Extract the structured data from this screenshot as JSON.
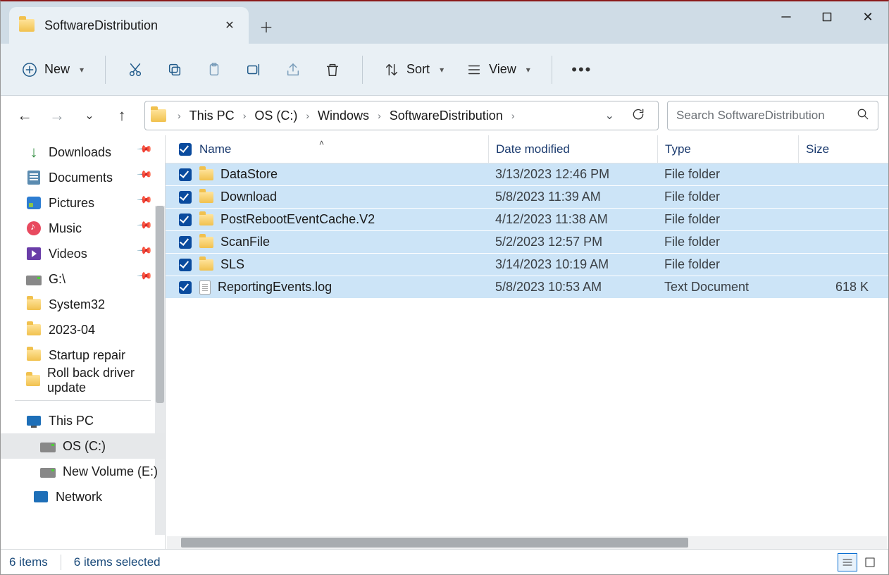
{
  "window": {
    "tab_title": "SoftwareDistribution"
  },
  "toolbar": {
    "new_label": "New",
    "sort_label": "Sort",
    "view_label": "View"
  },
  "breadcrumb": {
    "items": [
      "This PC",
      "OS (C:)",
      "Windows",
      "SoftwareDistribution"
    ]
  },
  "search": {
    "placeholder": "Search SoftwareDistribution"
  },
  "sidebar": {
    "quick": [
      {
        "label": "Downloads",
        "icon": "download",
        "pinned": true
      },
      {
        "label": "Documents",
        "icon": "doc",
        "pinned": true
      },
      {
        "label": "Pictures",
        "icon": "pic",
        "pinned": true
      },
      {
        "label": "Music",
        "icon": "music",
        "pinned": true
      },
      {
        "label": "Videos",
        "icon": "vid",
        "pinned": true
      },
      {
        "label": "G:\\",
        "icon": "drive",
        "pinned": true
      },
      {
        "label": "System32",
        "icon": "folder",
        "pinned": false
      },
      {
        "label": "2023-04",
        "icon": "folder",
        "pinned": false
      },
      {
        "label": "Startup repair",
        "icon": "folder",
        "pinned": false
      },
      {
        "label": "Roll back driver update",
        "icon": "folder",
        "pinned": false
      }
    ],
    "pc_label": "This PC",
    "drives": [
      {
        "label": "OS (C:)",
        "selected": true
      },
      {
        "label": "New Volume (E:)",
        "selected": false
      }
    ],
    "network_label": "Network"
  },
  "columns": {
    "name": "Name",
    "date": "Date modified",
    "type": "Type",
    "size": "Size"
  },
  "files": [
    {
      "name": "DataStore",
      "date": "3/13/2023 12:46 PM",
      "type": "File folder",
      "size": "",
      "icon": "folder",
      "selected": true
    },
    {
      "name": "Download",
      "date": "5/8/2023 11:39 AM",
      "type": "File folder",
      "size": "",
      "icon": "folder",
      "selected": true
    },
    {
      "name": "PostRebootEventCache.V2",
      "date": "4/12/2023 11:38 AM",
      "type": "File folder",
      "size": "",
      "icon": "folder",
      "selected": true
    },
    {
      "name": "ScanFile",
      "date": "5/2/2023 12:57 PM",
      "type": "File folder",
      "size": "",
      "icon": "folder",
      "selected": true
    },
    {
      "name": "SLS",
      "date": "3/14/2023 10:19 AM",
      "type": "File folder",
      "size": "",
      "icon": "folder",
      "selected": true
    },
    {
      "name": "ReportingEvents.log",
      "date": "5/8/2023 10:53 AM",
      "type": "Text Document",
      "size": "618 K",
      "icon": "txt",
      "selected": true
    }
  ],
  "status": {
    "count": "6 items",
    "selected": "6 items selected"
  }
}
